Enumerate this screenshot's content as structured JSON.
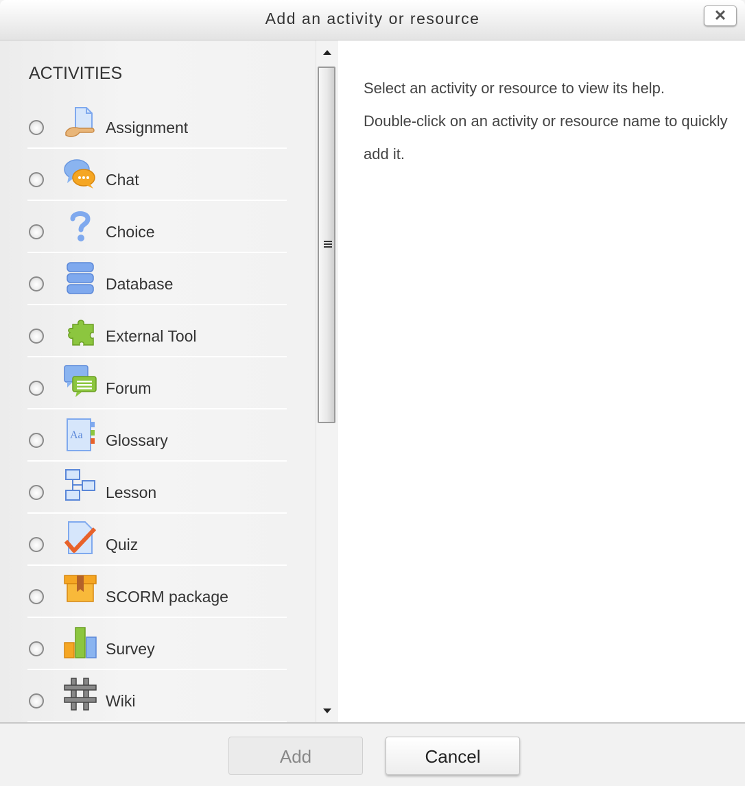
{
  "dialog": {
    "title": "Add an activity or resource",
    "close_label": "✕"
  },
  "activities": {
    "section_title": "ACTIVITIES",
    "items": [
      {
        "label": "Assignment",
        "icon": "assignment-icon",
        "selected": false
      },
      {
        "label": "Chat",
        "icon": "chat-icon",
        "selected": false
      },
      {
        "label": "Choice",
        "icon": "choice-icon",
        "selected": false
      },
      {
        "label": "Database",
        "icon": "database-icon",
        "selected": false
      },
      {
        "label": "External Tool",
        "icon": "external-tool-icon",
        "selected": false
      },
      {
        "label": "Forum",
        "icon": "forum-icon",
        "selected": false
      },
      {
        "label": "Glossary",
        "icon": "glossary-icon",
        "selected": false
      },
      {
        "label": "Lesson",
        "icon": "lesson-icon",
        "selected": false
      },
      {
        "label": "Quiz",
        "icon": "quiz-icon",
        "selected": false
      },
      {
        "label": "SCORM package",
        "icon": "scorm-package-icon",
        "selected": false
      },
      {
        "label": "Survey",
        "icon": "survey-icon",
        "selected": false
      },
      {
        "label": "Wiki",
        "icon": "wiki-icon",
        "selected": false
      }
    ]
  },
  "help": {
    "line1": "Select an activity or resource to view its help.",
    "line2": "Double-click on an activity or resource name to quickly add it."
  },
  "footer": {
    "add_label": "Add",
    "add_disabled": true,
    "cancel_label": "Cancel"
  },
  "colors": {
    "icon_blue": "#7fa9ee",
    "icon_green": "#8cc63f",
    "icon_orange": "#f5a623",
    "quiz_check": "#e8622a"
  }
}
